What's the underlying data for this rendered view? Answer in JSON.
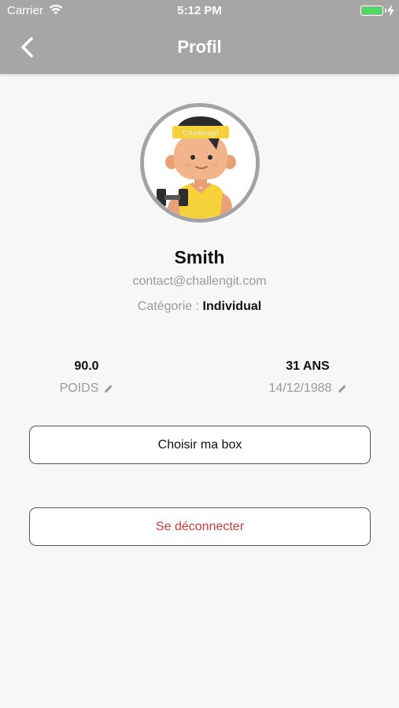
{
  "status_bar": {
    "carrier": "Carrier",
    "time": "5:12 PM",
    "battery_level": 1.0,
    "battery_color": "#4cd964"
  },
  "nav": {
    "title": "Profil",
    "back_icon": "chevron-left-icon",
    "bar_color": "#a6a6a6"
  },
  "profile": {
    "avatar_headband_text": "Challengit",
    "name": "Smith",
    "email": "contact@challengit.com",
    "category_label": "Catégorie :",
    "category_value": "Individual"
  },
  "stats": {
    "weight_value": "90.0",
    "weight_label": "POIDS",
    "age_value": "31 ANS",
    "birthdate_label": "14/12/1988",
    "edit_icon": "pencil-icon"
  },
  "actions": {
    "choose_box_label": "Choisir ma box",
    "logout_label": "Se déconnecter",
    "logout_color": "#cc3a3a"
  }
}
